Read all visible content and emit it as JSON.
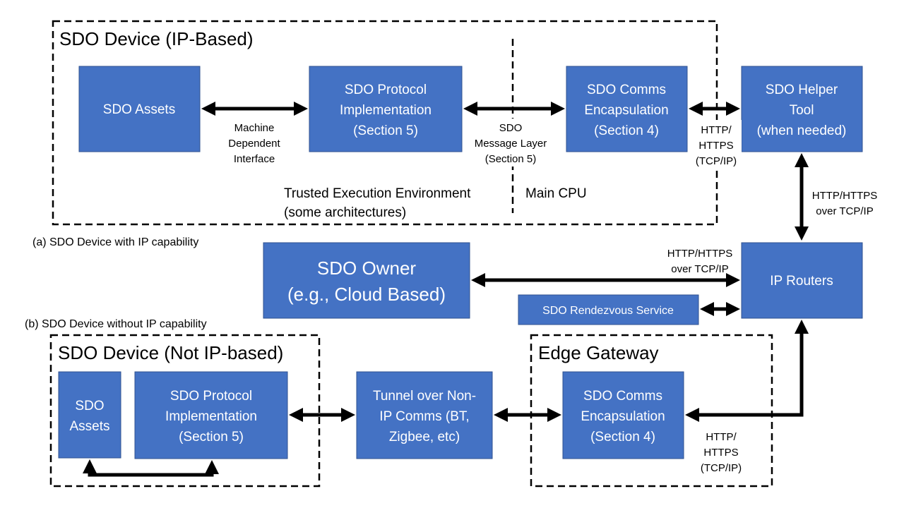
{
  "colors": {
    "box": "#4472C4",
    "box_text": "#FFFFFF",
    "lines": "#000000"
  },
  "ip_device": {
    "title": "SDO Device (IP-Based)",
    "assets": [
      "SDO Assets"
    ],
    "protocol": [
      "SDO Protocol",
      "Implementation",
      "(Section 5)"
    ],
    "comms": [
      "SDO Comms",
      "Encapsulation",
      "(Section 4)"
    ],
    "mdi_label": [
      "Machine",
      "Dependent",
      "Interface"
    ],
    "msg_label": [
      "SDO",
      "Message Layer",
      "(Section 5)"
    ],
    "tee_label": [
      "Trusted Execution Environment",
      "(some architectures)"
    ],
    "cpu_label": "Main CPU"
  },
  "helper": [
    "SDO Helper",
    "Tool",
    "(when needed)"
  ],
  "http_label_1": [
    "HTTP/",
    "HTTPS",
    "(TCP/IP)"
  ],
  "helper_router_label": [
    "HTTP/HTTPS",
    "over TCP/IP"
  ],
  "caption_a": "(a) SDO Device with IP capability",
  "owner": [
    "SDO Owner",
    "(e.g., Cloud Based)"
  ],
  "owner_router_label": [
    "HTTP/HTTPS",
    "over TCP/IP"
  ],
  "routers": "IP Routers",
  "rendezvous": "SDO Rendezvous  Service",
  "caption_b": "(b) SDO Device without IP capability",
  "nonip_device": {
    "title": "SDO Device (Not IP-based)",
    "assets": [
      "SDO",
      "Assets"
    ],
    "protocol": [
      "SDO Protocol",
      "Implementation",
      "(Section 5)"
    ]
  },
  "tunnel": [
    "Tunnel over Non-",
    "IP Comms (BT,",
    "Zigbee, etc)"
  ],
  "gateway": {
    "title": "Edge Gateway",
    "comms": [
      "SDO Comms",
      "Encapsulation",
      "(Section 4)"
    ]
  },
  "http_label_2": [
    "HTTP/",
    "HTTPS",
    "(TCP/IP)"
  ]
}
